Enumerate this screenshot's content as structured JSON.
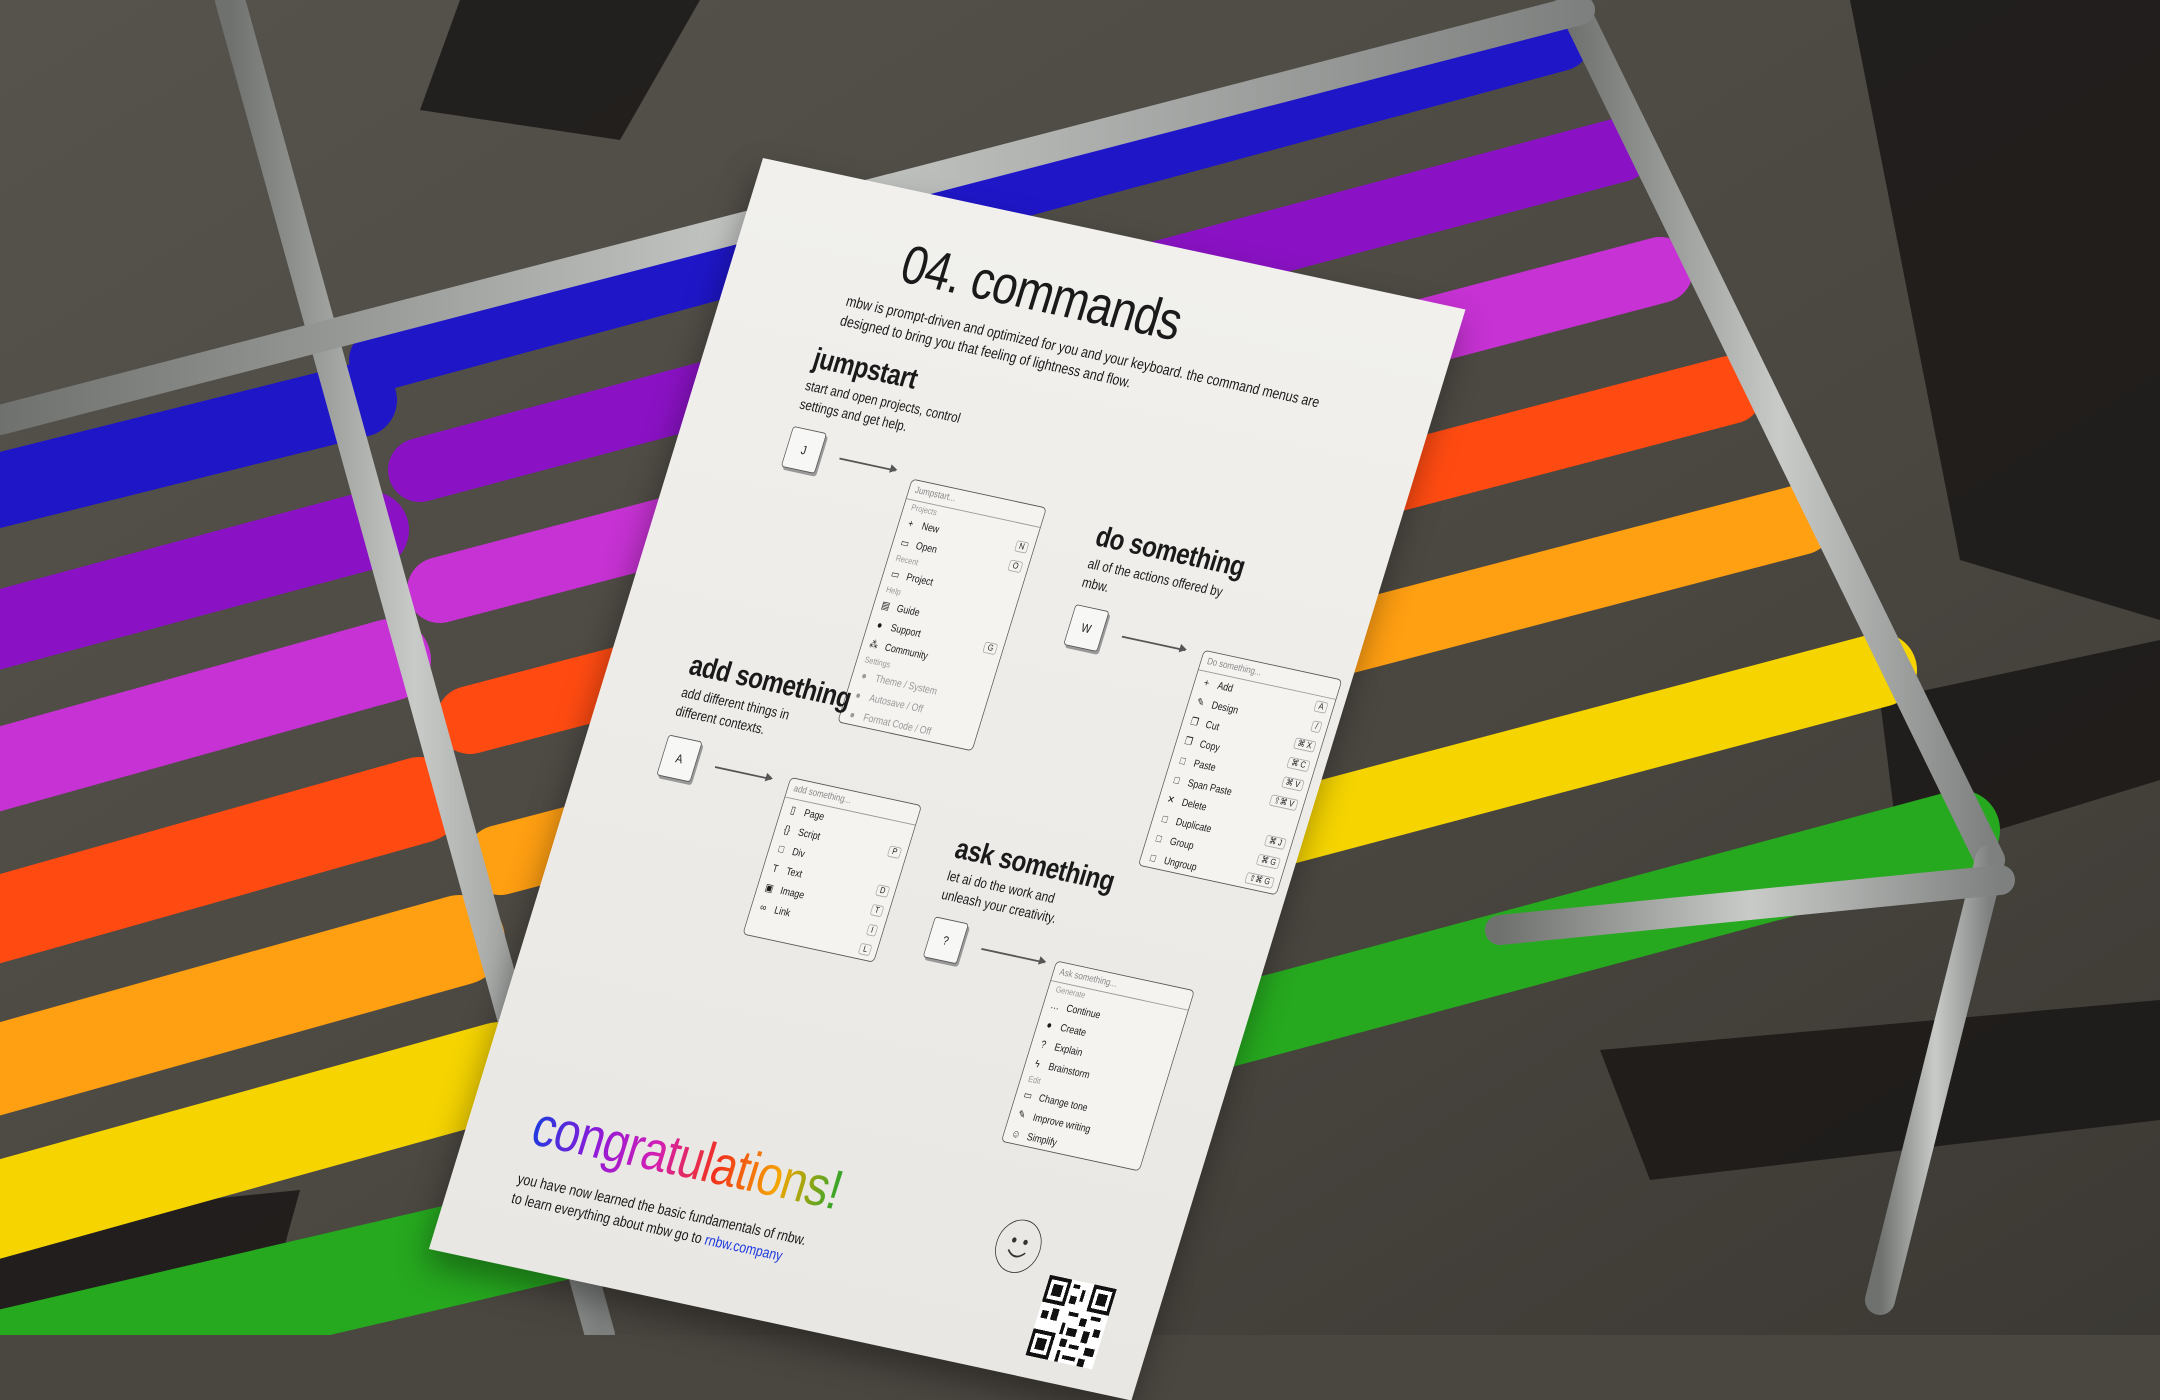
{
  "scene": {
    "colors": {
      "floor": "#4a4640",
      "chair_frame": "#a8aaa8",
      "slats": [
        "#1f16c8",
        "#8a12c4",
        "#c632d3",
        "#ff4b12",
        "#ff9f12",
        "#f5d400",
        "#26a81f"
      ]
    }
  },
  "paper": {
    "title": "04. commands",
    "intro": "mbw is prompt-driven and optimized for you and your keyboard. the command menus are designed to bring you that feeling of lightness and flow.",
    "sections": {
      "jumpstart": {
        "heading": "jumpstart",
        "description": "start and open projects, control settings and get help.",
        "key": "J",
        "menu": {
          "header": "Jumpstart...",
          "groups": [
            {
              "label": "Projects",
              "items": [
                {
                  "icon": "plus-icon",
                  "label": "New",
                  "shortcut": "N"
                },
                {
                  "icon": "folder-icon",
                  "label": "Open",
                  "shortcut": "O"
                }
              ]
            },
            {
              "label": "Recent",
              "items": [
                {
                  "icon": "folder-icon",
                  "label": "Project",
                  "shortcut": ""
                }
              ]
            },
            {
              "label": "Help",
              "items": [
                {
                  "icon": "guide-icon",
                  "label": "Guide",
                  "shortcut": ""
                },
                {
                  "icon": "person-icon",
                  "label": "Support",
                  "shortcut": "G"
                },
                {
                  "icon": "people-icon",
                  "label": "Community",
                  "shortcut": ""
                }
              ]
            },
            {
              "label": "Settings",
              "items": [
                {
                  "icon": "dot-icon",
                  "label": "Theme / System",
                  "shortcut": "",
                  "dim": true
                },
                {
                  "icon": "dot-icon",
                  "label": "Autosave / Off",
                  "shortcut": "",
                  "dim": true
                },
                {
                  "icon": "dot-icon",
                  "label": "Format Code / Off",
                  "shortcut": "",
                  "dim": true
                }
              ]
            }
          ]
        }
      },
      "do_something": {
        "heading": "do something",
        "description": "all of the actions offered by mbw.",
        "key": "W",
        "menu": {
          "header": "Do something...",
          "items": [
            {
              "icon": "plus-icon",
              "label": "Add",
              "shortcut": "A"
            },
            {
              "icon": "pen-icon",
              "label": "Design",
              "shortcut": "/"
            },
            {
              "icon": "copy-icon",
              "label": "Cut",
              "shortcut": "⌘ X"
            },
            {
              "icon": "copy-icon",
              "label": "Copy",
              "shortcut": "⌘ C"
            },
            {
              "icon": "square-icon",
              "label": "Paste",
              "shortcut": "⌘ V"
            },
            {
              "icon": "square-icon",
              "label": "Span Paste",
              "shortcut": "⇧⌘ V"
            },
            {
              "icon": "close-icon",
              "label": "Delete",
              "shortcut": ""
            },
            {
              "icon": "square-icon",
              "label": "Duplicate",
              "shortcut": "⌘ J"
            },
            {
              "icon": "square-icon",
              "label": "Group",
              "shortcut": "⌘ G"
            },
            {
              "icon": "square-icon",
              "label": "Ungroup",
              "shortcut": "⇧⌘ G"
            }
          ]
        }
      },
      "add_something": {
        "heading": "add something",
        "description": "add different things in different contexts.",
        "key": "A",
        "menu": {
          "header": "add something...",
          "items": [
            {
              "icon": "page-icon",
              "label": "Page",
              "shortcut": ""
            },
            {
              "icon": "braces-icon",
              "label": "Script",
              "shortcut": "P"
            },
            {
              "icon": "square-icon",
              "label": "Div",
              "shortcut": ""
            },
            {
              "icon": "text-icon",
              "label": "Text",
              "shortcut": "D"
            },
            {
              "icon": "image-icon",
              "label": "Image",
              "shortcut": "T"
            },
            {
              "icon": "link-icon",
              "label": "Link",
              "shortcut": "I"
            },
            {
              "icon": "",
              "label": "",
              "shortcut": "L"
            }
          ]
        }
      },
      "ask_something": {
        "heading": "ask something",
        "description": "let ai do the work and unleash your creativity.",
        "key": "?",
        "menu": {
          "header": "Ask something...",
          "groups": [
            {
              "label": "Generate",
              "items": [
                {
                  "icon": "ellipsis-icon",
                  "label": "Continue"
                },
                {
                  "icon": "dot-icon",
                  "label": "Create"
                },
                {
                  "icon": "question-icon",
                  "label": "Explain"
                },
                {
                  "icon": "bolt-icon",
                  "label": "Brainstorm"
                }
              ]
            },
            {
              "label": "Edit",
              "items": [
                {
                  "icon": "speech-icon",
                  "label": "Change tone"
                },
                {
                  "icon": "pen-icon",
                  "label": "Improve writing"
                },
                {
                  "icon": "smile-icon",
                  "label": "Simplify"
                }
              ]
            }
          ]
        }
      }
    },
    "congratulations": "congratulations!",
    "footer_line1": "you have now learned the basic fundamentals of rnbw.",
    "footer_line2": "to learn everything about mbw go to",
    "footer_link": "rnbw.company"
  }
}
